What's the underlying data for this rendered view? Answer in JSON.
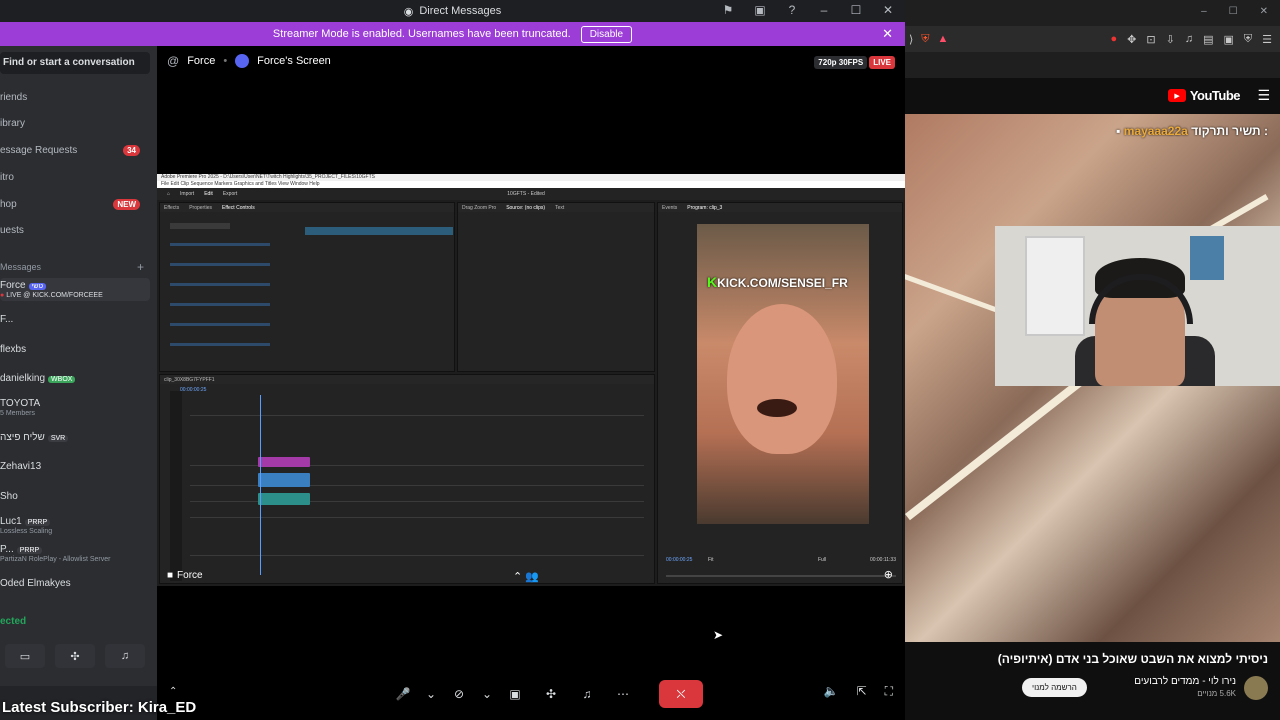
{
  "discord": {
    "window_title": "Direct Messages",
    "streamer_bar": {
      "text": "Streamer Mode is enabled. Usernames have been truncated.",
      "button": "Disable"
    },
    "search_placeholder": "Find or start a conversation",
    "nav": [
      {
        "label": "riends"
      },
      {
        "label": "ibrary"
      },
      {
        "label": "essage Requests",
        "badge": "34"
      },
      {
        "label": "itro"
      },
      {
        "label": "hop",
        "badge": "NEW"
      },
      {
        "label": "uests"
      }
    ],
    "dm_header": "Messages",
    "dms": [
      {
        "name": "Force",
        "tag": "טשי",
        "sub": "LIVE @ KICK.COM/FORCEEE"
      },
      {
        "name": "F...",
        "tag": "",
        "sub": ""
      },
      {
        "name": "flexbs",
        "tag": "",
        "sub": ""
      },
      {
        "name": "danielking",
        "tag": "WBOX",
        "sub": ""
      },
      {
        "name": "TOYOTA",
        "tag": "",
        "sub": "5 Members"
      },
      {
        "name": "שליח פיצה",
        "tag": "SVR",
        "sub": ""
      },
      {
        "name": "Zehavi13",
        "tag": "",
        "sub": ""
      },
      {
        "name": "Sho",
        "tag": "",
        "sub": ""
      },
      {
        "name": "Luc1",
        "tag": "PRRP",
        "sub": "Lossless Scaling"
      },
      {
        "name": "P...",
        "tag": "PRRP",
        "sub": "PartizaN RolePlay - Allowlist Server"
      },
      {
        "name": "Oded Elmakyes",
        "tag": "",
        "sub": ""
      }
    ],
    "voice_status": "ected",
    "stream": {
      "user": "Force",
      "screen": "Force's Screen",
      "quality": "720p 30FPS",
      "live": "LIVE",
      "footer_user": "Force",
      "kick_overlay": "KICK.COM/SENSEI_FR"
    },
    "latest_subscriber": "Latest Subscriber: Kira_ED"
  },
  "premiere": {
    "title": "Adobe Premiere Pro 2025 - D:\\Users\\User\\NET\\Twitch Highlights\\35_PROJECT_FILES\\10GFTS",
    "menu": "File  Edit  Clip  Sequence  Markers  Graphics and Titles  View  Window  Help",
    "tabs": [
      "Import",
      "Edit",
      "Export"
    ],
    "project_label": "10GFTS - Edited",
    "timecode_program": "00:00:00:25",
    "timecode_end": "00:00:11:33",
    "fit_label": "Fit",
    "full_label": "Full"
  },
  "youtube": {
    "logo": "YouTube",
    "chat_user": "mayaaa22a",
    "chat_text": "תשיר ותרקוד :",
    "video_title": "ניסיתי למצוא את השבט שאוכל בני אדם (איתיופיה)",
    "channel": "נירו לוי - ממדים לרבועים",
    "subs": "5.6K מנויים",
    "subscribe": "הרשמה למנוי"
  },
  "colors": {
    "streamer_bar": "#9b3dd6",
    "live_red": "#da373c",
    "kick_green": "#53fc18",
    "yt_red": "#ff0000"
  }
}
